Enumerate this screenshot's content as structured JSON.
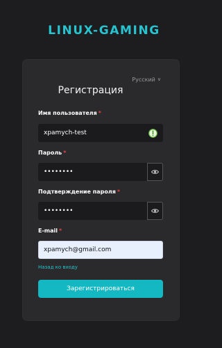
{
  "brand": {
    "name": "LINUX-GAMING",
    "color": "#27c3cf"
  },
  "form": {
    "language": "Русский",
    "title": "Регистрация",
    "username": {
      "label": "Имя пользователя",
      "required_mark": "*",
      "value": "xpamych-test",
      "status_icon": "check-circle-icon"
    },
    "password": {
      "label": "Пароль",
      "required_mark": "*",
      "value": "••••••••",
      "toggle_icon": "eye-icon"
    },
    "password_confirm": {
      "label": "Подтверждение пароля",
      "required_mark": "*",
      "value": "••••••••",
      "toggle_icon": "eye-icon"
    },
    "email": {
      "label": "E-mail",
      "required_mark": "*",
      "value": "xpamych@gmail.com"
    },
    "back_link": "Назад ко входу",
    "submit_label": "Зарегистрироваться"
  }
}
